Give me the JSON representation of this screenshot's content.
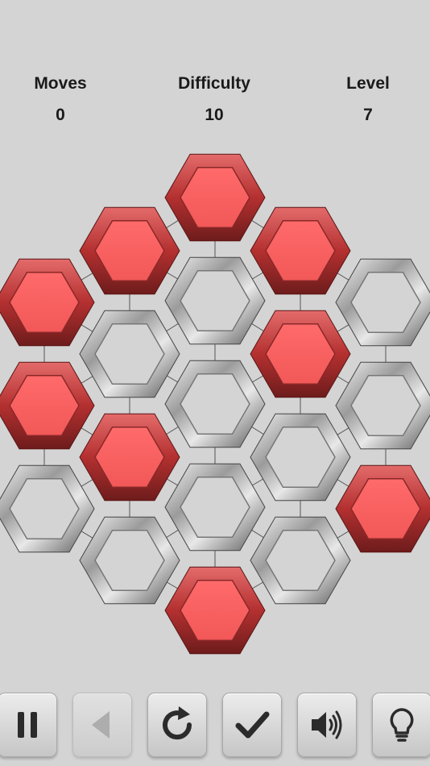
{
  "stats": {
    "moves": {
      "label": "Moves",
      "value": "0"
    },
    "difficulty": {
      "label": "Difficulty",
      "value": "10"
    },
    "level": {
      "label": "Level",
      "value": "7"
    }
  },
  "board": {
    "colors": {
      "active": "#f06262",
      "active_rim": "#c23a3a",
      "inactive_rim": "#9a9a9a",
      "background": "#d4d4d4"
    },
    "columns": [
      [
        "active",
        "active",
        "inactive"
      ],
      [
        "active",
        "inactive",
        "active",
        "inactive"
      ],
      [
        "active",
        "inactive",
        "inactive",
        "inactive",
        "active"
      ],
      [
        "active",
        "active",
        "inactive",
        "inactive"
      ],
      [
        "inactive",
        "inactive",
        "active"
      ]
    ]
  },
  "toolbar": {
    "buttons": [
      {
        "name": "pause",
        "icon": "pause-icon",
        "enabled": true
      },
      {
        "name": "back",
        "icon": "back-arrow-icon",
        "enabled": false
      },
      {
        "name": "restart",
        "icon": "restart-icon",
        "enabled": true
      },
      {
        "name": "check",
        "icon": "checkmark-icon",
        "enabled": true
      },
      {
        "name": "sound",
        "icon": "speaker-icon",
        "enabled": true
      },
      {
        "name": "hint",
        "icon": "lightbulb-icon",
        "enabled": true
      }
    ]
  }
}
